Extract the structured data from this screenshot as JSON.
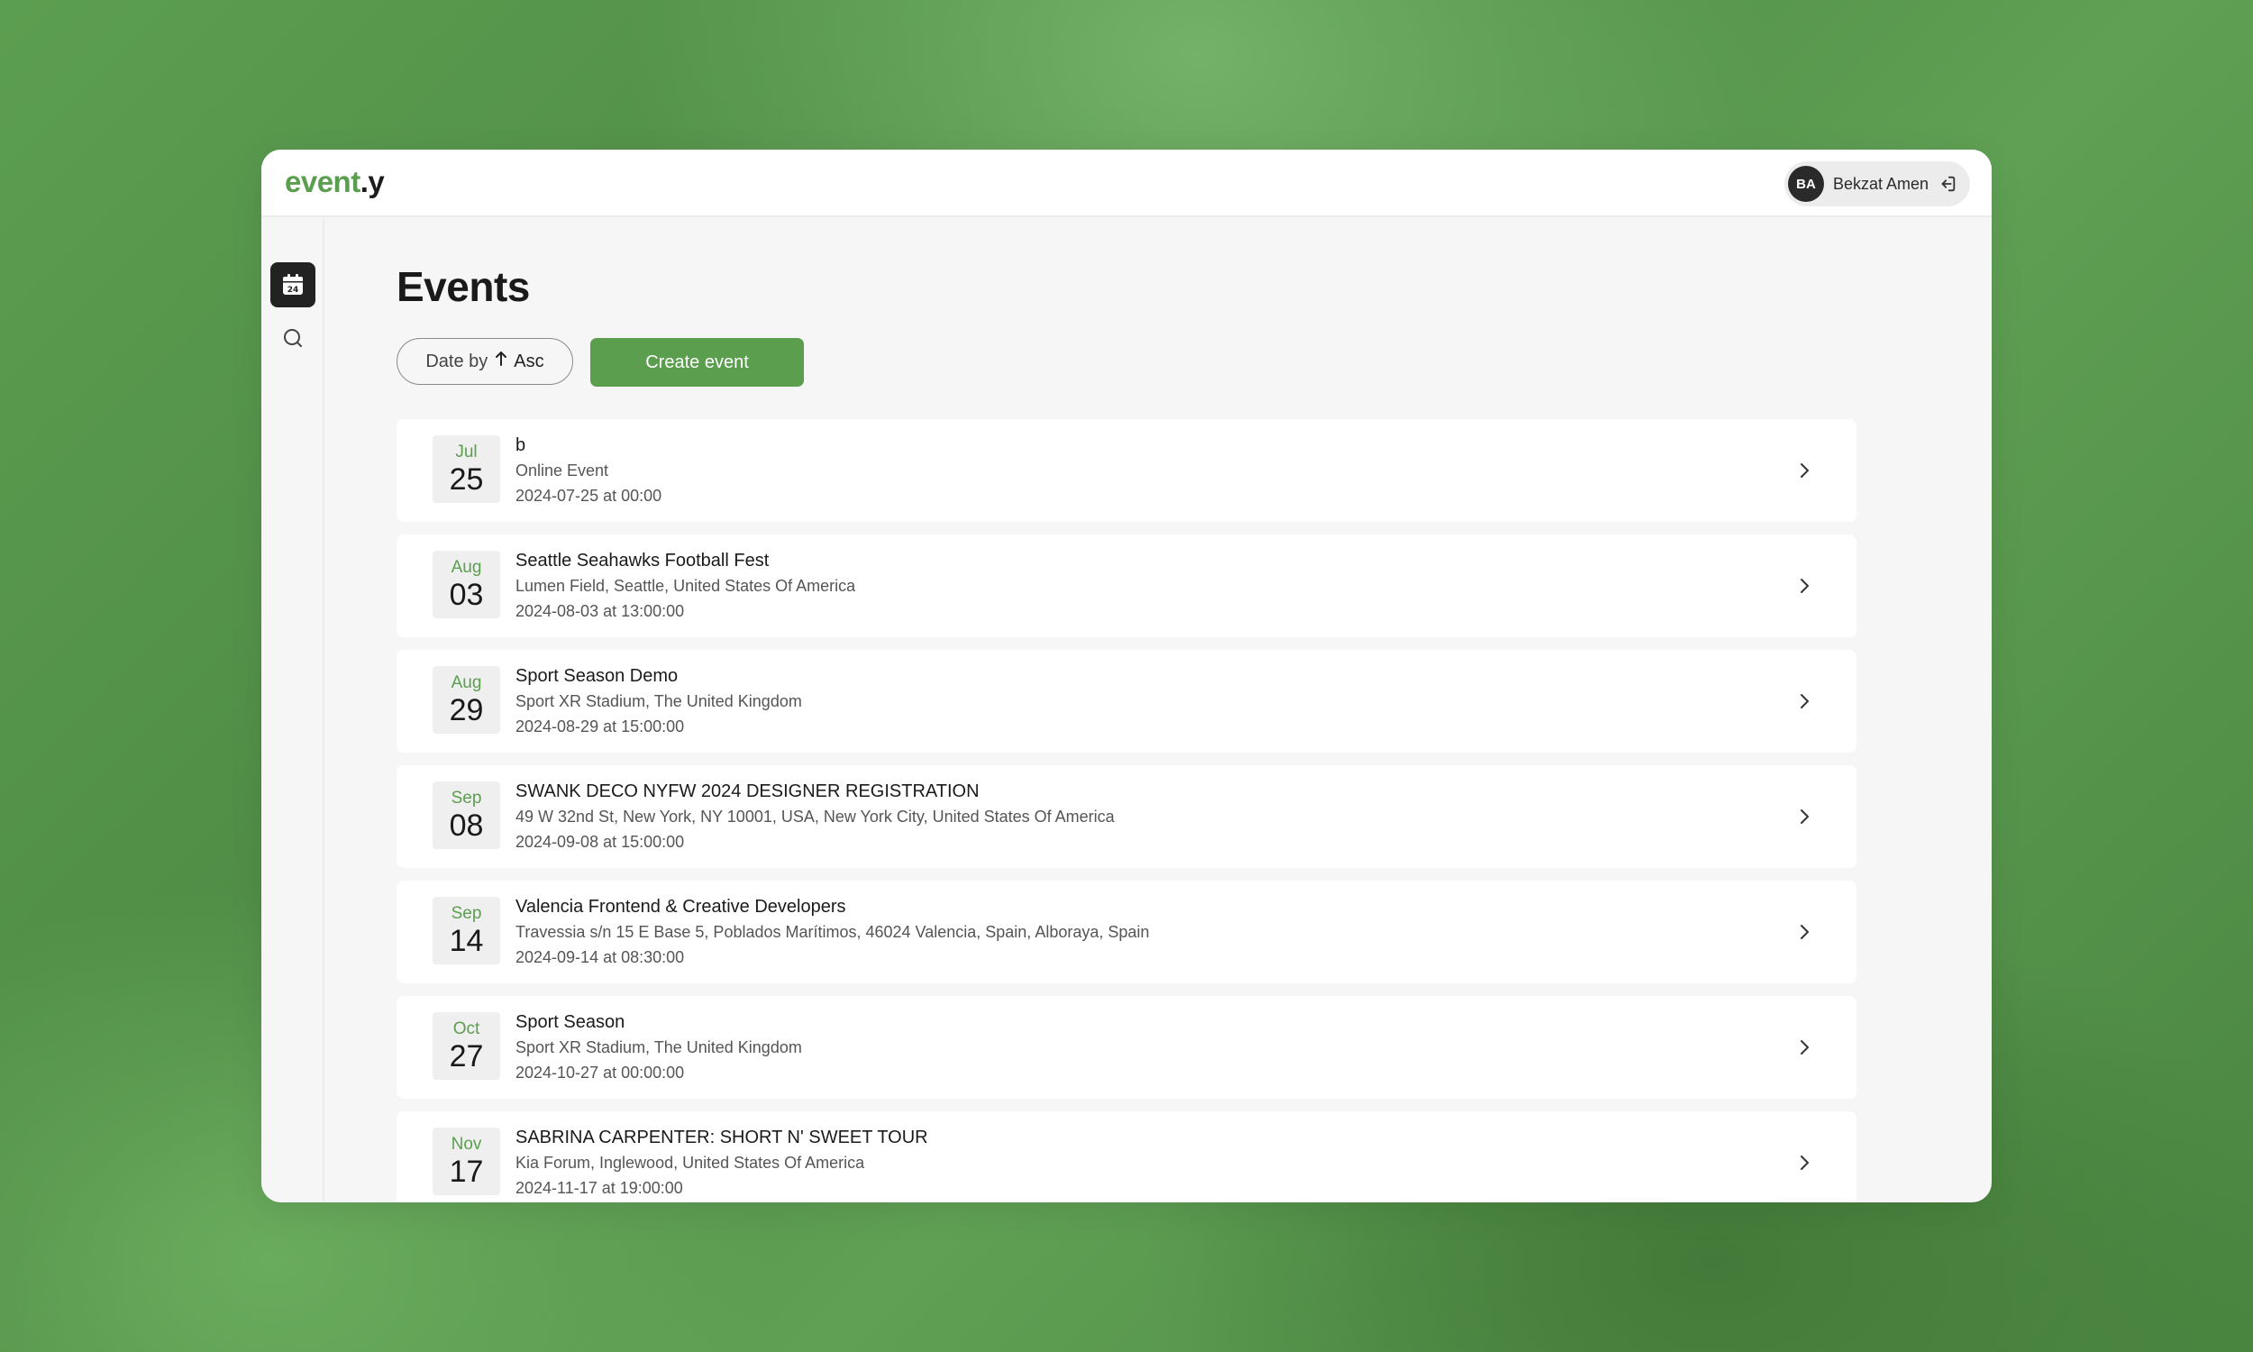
{
  "app": {
    "logo_main": "event",
    "logo_suffix": ".y"
  },
  "user": {
    "initials": "BA",
    "name": "Bekzat Amen"
  },
  "sidebar": {
    "calendar_icon_day": "24"
  },
  "page": {
    "title": "Events",
    "sort_label": "Date by",
    "sort_direction": "Asc",
    "create_label": "Create event"
  },
  "colors": {
    "accent": "#5a9e4e",
    "dark": "#222222"
  },
  "events": [
    {
      "month": "Jul",
      "day": "25",
      "title": "b",
      "location": "Online Event",
      "datetime": "2024-07-25 at 00:00"
    },
    {
      "month": "Aug",
      "day": "03",
      "title": "Seattle Seahawks Football Fest",
      "location": "Lumen Field, Seattle, United States Of America",
      "datetime": "2024-08-03 at 13:00:00"
    },
    {
      "month": "Aug",
      "day": "29",
      "title": "Sport Season Demo",
      "location": "Sport XR Stadium, The United Kingdom",
      "datetime": "2024-08-29 at 15:00:00"
    },
    {
      "month": "Sep",
      "day": "08",
      "title": "SWANK DECO NYFW 2024 DESIGNER REGISTRATION",
      "location": "49 W 32nd St, New York, NY 10001, USA, New York City, United States Of America",
      "datetime": "2024-09-08 at 15:00:00"
    },
    {
      "month": "Sep",
      "day": "14",
      "title": "Valencia Frontend & Creative Developers",
      "location": "Travessia s/n 15 E Base 5, Poblados Marítimos, 46024 Valencia, Spain, Alboraya, Spain",
      "datetime": "2024-09-14 at 08:30:00"
    },
    {
      "month": "Oct",
      "day": "27",
      "title": "Sport Season",
      "location": "Sport XR Stadium, The United Kingdom",
      "datetime": "2024-10-27 at 00:00:00"
    },
    {
      "month": "Nov",
      "day": "17",
      "title": "SABRINA CARPENTER: SHORT N' SWEET TOUR",
      "location": "Kia Forum, Inglewood, United States Of America",
      "datetime": "2024-11-17 at 19:00:00"
    }
  ]
}
